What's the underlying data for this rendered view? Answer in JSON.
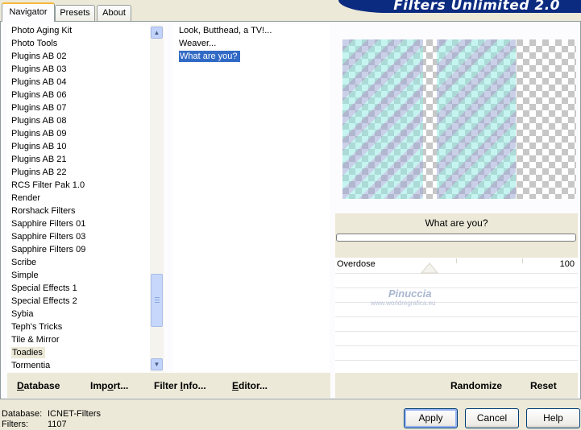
{
  "tabs": [
    "Navigator",
    "Presets",
    "About"
  ],
  "banner_title": "Filters Unlimited 2.0",
  "categories": [
    "Photo Aging Kit",
    "Photo Tools",
    "Plugins AB 02",
    "Plugins AB 03",
    "Plugins AB 04",
    "Plugins AB 06",
    "Plugins AB 07",
    "Plugins AB 08",
    "Plugins AB 09",
    "Plugins AB 10",
    "Plugins AB 21",
    "Plugins AB 22",
    "RCS Filter Pak 1.0",
    "Render",
    "Rorshack Filters",
    "Sapphire Filters 01",
    "Sapphire Filters 03",
    "Sapphire Filters 09",
    "Scribe",
    "Simple",
    "Special Effects 1",
    "Special Effects 2",
    "Sybia",
    "Teph's Tricks",
    "Tile & Mirror",
    "Toadies",
    "Tormentia"
  ],
  "selected_category": "Toadies",
  "filters": [
    "Look, Butthead, a TV!...",
    "Weaver...",
    "What are you?"
  ],
  "selected_filter": "What are you?",
  "preview_filter_name": "What are you?",
  "parameter": {
    "label": "Overdose",
    "value": "100"
  },
  "watermark": {
    "name": "Pinuccia",
    "url": "www.worldregrafica.eu"
  },
  "commands": {
    "database": {
      "u": "D",
      "rest": "atabase"
    },
    "import": {
      "pre": "Imp",
      "u": "o",
      "rest": "rt..."
    },
    "filter_info": {
      "pre": "Filter ",
      "u": "I",
      "rest": "nfo..."
    },
    "editor": {
      "u": "E",
      "rest": "ditor..."
    },
    "randomize": "Randomize",
    "reset": "Reset"
  },
  "status": {
    "database_label": "Database:",
    "database_value": "ICNET-Filters",
    "filters_label": "Filters:",
    "filters_value": "1107"
  },
  "buttons": {
    "apply": "Apply",
    "cancel": "Cancel",
    "help": "Help"
  }
}
